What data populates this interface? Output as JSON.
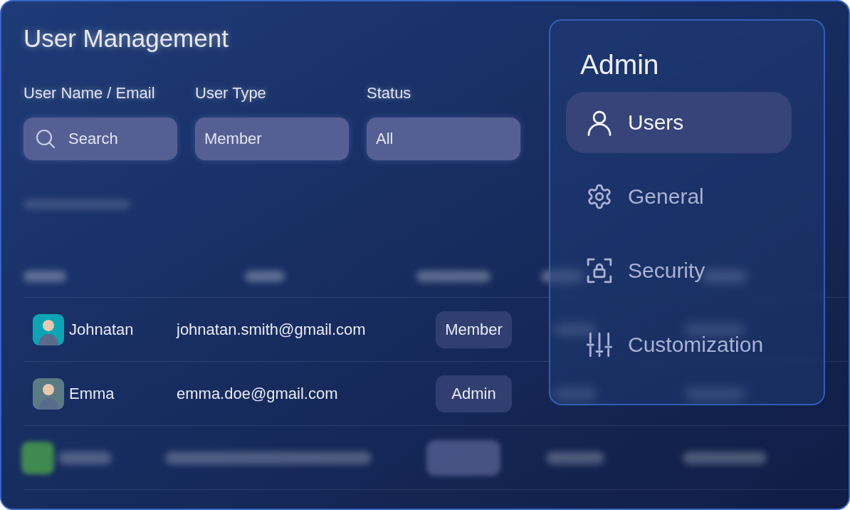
{
  "title": "User Management",
  "filters": [
    {
      "label": "User Name / Email",
      "kind": "search",
      "placeholder": "Search"
    },
    {
      "label": "User Type",
      "kind": "select",
      "value": "Member"
    },
    {
      "label": "Status",
      "kind": "select",
      "value": "All"
    }
  ],
  "table": {
    "rows": [
      {
        "name": "Johnatan",
        "email": "johnatan.smith@gmail.com",
        "user_type": "Member",
        "color": "#0aa5b4"
      },
      {
        "name": "Emma",
        "email": "emma.doe@gmail.com",
        "user_type": "Admin",
        "color": "#5b7b82"
      }
    ]
  },
  "panel": {
    "title": "Admin",
    "items": [
      {
        "label": "Users",
        "selected": true
      },
      {
        "label": "General",
        "selected": false
      },
      {
        "label": "Security",
        "selected": false
      },
      {
        "label": "Customization",
        "selected": false
      }
    ]
  }
}
